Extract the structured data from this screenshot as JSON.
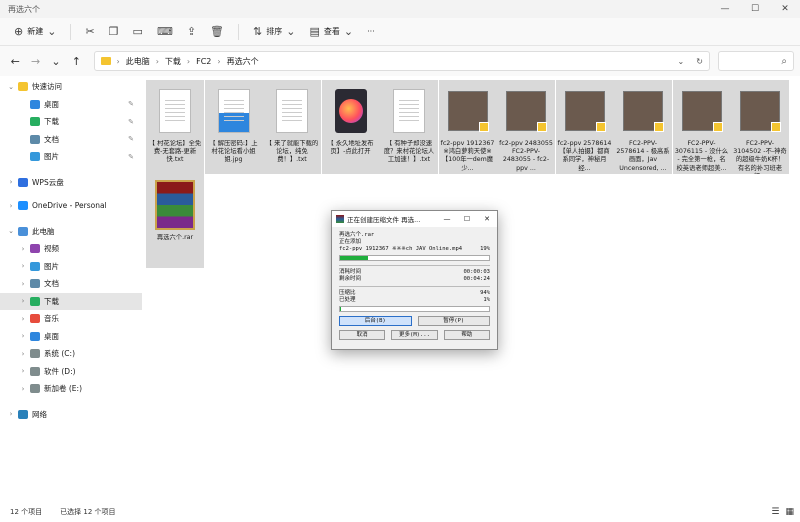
{
  "window": {
    "title": "再选六个",
    "minimize": "—",
    "maximize": "☐",
    "close": "✕"
  },
  "toolbar": {
    "new": "新建",
    "sort": "排序",
    "view": "查看",
    "more": "···"
  },
  "address": {
    "segments": [
      "此电脑",
      "下载",
      "FC2",
      "再选六个"
    ]
  },
  "sidebar": [
    {
      "label": "快速访问",
      "exp": "⌄",
      "color": "#f4c430",
      "pin": ""
    },
    {
      "label": "桌面",
      "exp": "",
      "color": "#2e86de",
      "pin": "✎"
    },
    {
      "label": "下载",
      "exp": "",
      "color": "#27ae60",
      "pin": "✎"
    },
    {
      "label": "文档",
      "exp": "",
      "color": "#5d8aa8",
      "pin": "✎"
    },
    {
      "label": "图片",
      "exp": "",
      "color": "#3498db",
      "pin": "✎"
    },
    {
      "label": "WPS云盘",
      "exp": "›",
      "color": "#2f6fdf",
      "pin": ""
    },
    {
      "label": "OneDrive - Personal",
      "exp": "›",
      "color": "#1e90ff",
      "pin": ""
    },
    {
      "label": "此电脑",
      "exp": "⌄",
      "color": "#4a90d9",
      "pin": ""
    },
    {
      "label": "视频",
      "exp": "›",
      "color": "#8e44ad",
      "pin": ""
    },
    {
      "label": "图片",
      "exp": "›",
      "color": "#3498db",
      "pin": ""
    },
    {
      "label": "文档",
      "exp": "›",
      "color": "#5d8aa8",
      "pin": ""
    },
    {
      "label": "下载",
      "exp": "›",
      "color": "#27ae60",
      "pin": ""
    },
    {
      "label": "音乐",
      "exp": "›",
      "color": "#e74c3c",
      "pin": ""
    },
    {
      "label": "桌面",
      "exp": "›",
      "color": "#2e86de",
      "pin": ""
    },
    {
      "label": "系统 (C:)",
      "exp": "›",
      "color": "#7f8c8d",
      "pin": ""
    },
    {
      "label": "软件 (D:)",
      "exp": "›",
      "color": "#7f8c8d",
      "pin": ""
    },
    {
      "label": "新加卷 (E:)",
      "exp": "›",
      "color": "#7f8c8d",
      "pin": ""
    },
    {
      "label": "网络",
      "exp": "›",
      "color": "#2980b9",
      "pin": ""
    }
  ],
  "files": [
    {
      "kind": "txt",
      "name": "【 村花论坛】全免费-无套路-更新快.txt"
    },
    {
      "kind": "jpg",
      "name": "【 解压密码:】上村花论坛看小姐姐.jpg"
    },
    {
      "kind": "txt",
      "name": "【 来了就能下载的论坛，纯免费！】.txt"
    },
    {
      "kind": "url",
      "name": "【 永久地址发布页】-点此打开"
    },
    {
      "kind": "txt",
      "name": "【 有种子却没速度？来村花论坛人工加速！】.txt"
    },
    {
      "kind": "video",
      "name": "fc2-ppv 1912367 ※鸿白萝莉天使※【100年一dem魔少..."
    },
    {
      "kind": "video",
      "name": "fc2-ppv 2483055 FC2-PPV-2483055 - fc2-ppv ..."
    },
    {
      "kind": "video",
      "name": "fc2-ppv 2578614 【单人拍摄】都商系同学，神秘月经..."
    },
    {
      "kind": "video",
      "name": "FC2-PPV-2578614 - 极高系画面，Jav Uncensored, ..."
    },
    {
      "kind": "video",
      "name": "FC2-PPV-3076115 - 没什么 - 完全第一枪，名校英语老师超美..."
    },
    {
      "kind": "video",
      "name": "FC2-PPV-3104502 -不-神奇的超级牛奶K杯！有名的补习班老师..."
    },
    {
      "kind": "rar",
      "name": "再选六个.rar"
    }
  ],
  "status": {
    "count": "12 个项目",
    "selected": "已选择 12 个项目"
  },
  "dialog": {
    "title": "正在创建压缩文件 再选...",
    "archive": "再选六个.rar",
    "adding_label": "正在添加",
    "current_file": "fc2-ppv 1912367 ※※※ch JAV Online.mp4",
    "file_pct": "19%",
    "file_progress": 0.19,
    "elapsed_label": "消耗时间",
    "elapsed": "00:00:03",
    "remain_label": "剩余时间",
    "remain": "00:04:24",
    "ratio_label": "压缩比",
    "ratio": "94%",
    "processed_label": "已处理",
    "processed": "1%",
    "total_progress": 0.01,
    "btn_background": "后台(B)",
    "btn_pause": "暂停(P)",
    "btn_cancel": "取消",
    "btn_mode": "更多(M)...",
    "btn_help": "帮助"
  }
}
